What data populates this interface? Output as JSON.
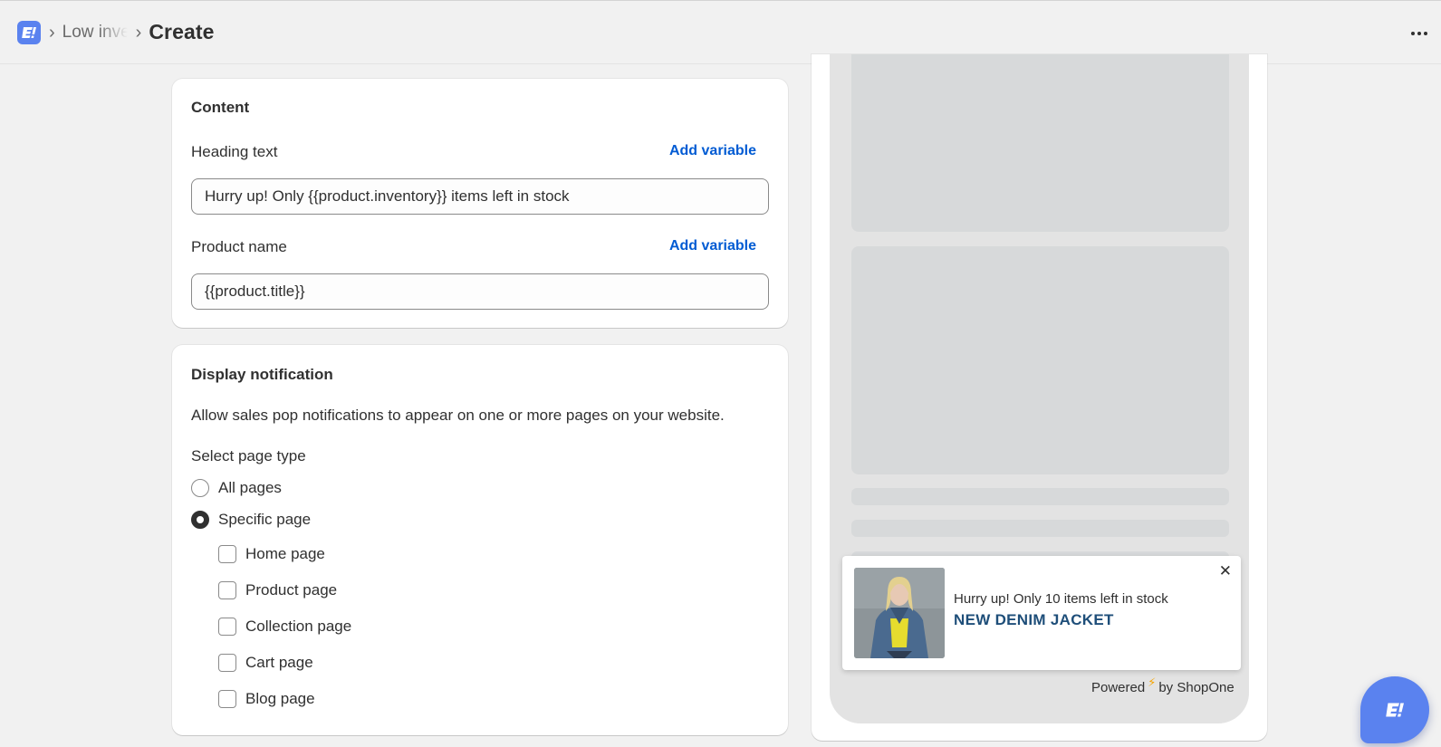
{
  "header": {
    "breadcrumb_parent": "Low inventory",
    "breadcrumb_current": "Create"
  },
  "content_card": {
    "title": "Content",
    "heading_label": "Heading text",
    "heading_add_variable": "Add variable",
    "heading_value": "Hurry up! Only {{product.inventory}} items left in stock",
    "product_label": "Product name",
    "product_add_variable": "Add variable",
    "product_value": "{{product.title}}"
  },
  "display_card": {
    "title": "Display notification",
    "description": "Allow sales pop notifications to appear on one or more pages on your website.",
    "select_label": "Select page type",
    "radios": [
      {
        "label": "All pages",
        "checked": false
      },
      {
        "label": "Specific page",
        "checked": true
      }
    ],
    "pages": [
      {
        "label": "Home page",
        "checked": false
      },
      {
        "label": "Product page",
        "checked": false
      },
      {
        "label": "Collection page",
        "checked": false
      },
      {
        "label": "Cart page",
        "checked": false
      },
      {
        "label": "Blog page",
        "checked": false
      }
    ]
  },
  "preview": {
    "popup_heading": "Hurry up! Only 10 items left in stock",
    "popup_product": "NEW DENIM JACKET",
    "powered_prefix": "Powered",
    "powered_suffix": "by ShopOne"
  },
  "icons": {
    "app_logo": "app-logo-icon",
    "more": "more-horizontal-icon",
    "close": "close-icon",
    "bolt": "lightning-bolt-icon",
    "fab": "app-chat-icon"
  },
  "colors": {
    "brand": "#5a82ef",
    "link": "#005bd3",
    "product_title": "#1e4e79",
    "bolt": "#f5a400"
  }
}
